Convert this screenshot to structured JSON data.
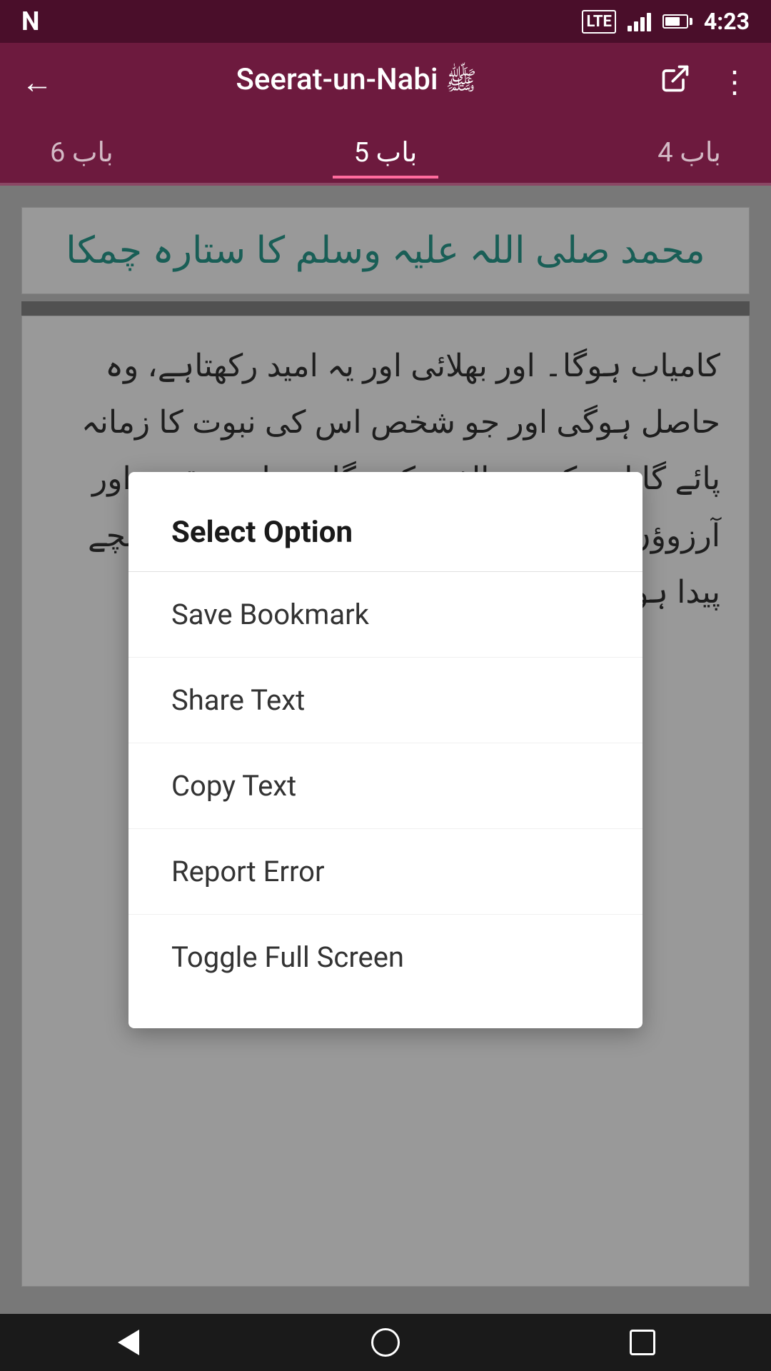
{
  "statusBar": {
    "logo": "N",
    "lte": "LTE",
    "time": "4:23"
  },
  "toolbar": {
    "title": "Seerat-un-Nabi",
    "titleArabic": "ﷺ",
    "backLabel": "←",
    "shareLabel": "⬡",
    "moreLabel": "⋮"
  },
  "tabs": {
    "left": "باب 6",
    "active": "باب 5",
    "right": "باب 4"
  },
  "page": {
    "headingUrdu": "محمد صلی اللہ علیہ وسلم کا ستارہ چمکا",
    "bodyUrdu": "کامیاب ہوگا۔ اور بھلائی اور یہ امید رکھتاہے، وہ حاصل ہوگی اور جو شخص اس کی نبوت کا زمانہ پائے گا اس کی مخالفت کرے گا، وہ اپنے مقصد اور آرزوؤں میں ناکام ہوگا۔ مکہ معظمہ میں جو بچے پیدا ہوتا، وہ یہودی اس کے بچے"
  },
  "modal": {
    "title": "Select Option",
    "options": [
      {
        "id": "save-bookmark",
        "label": "Save Bookmark"
      },
      {
        "id": "share-text",
        "label": "Share Text"
      },
      {
        "id": "copy-text",
        "label": "Copy Text"
      },
      {
        "id": "report-error",
        "label": "Report Error"
      },
      {
        "id": "toggle-fullscreen",
        "label": "Toggle Full Screen"
      }
    ]
  },
  "bottomNav": {
    "back": "◁",
    "home": "○",
    "recent": "□"
  }
}
